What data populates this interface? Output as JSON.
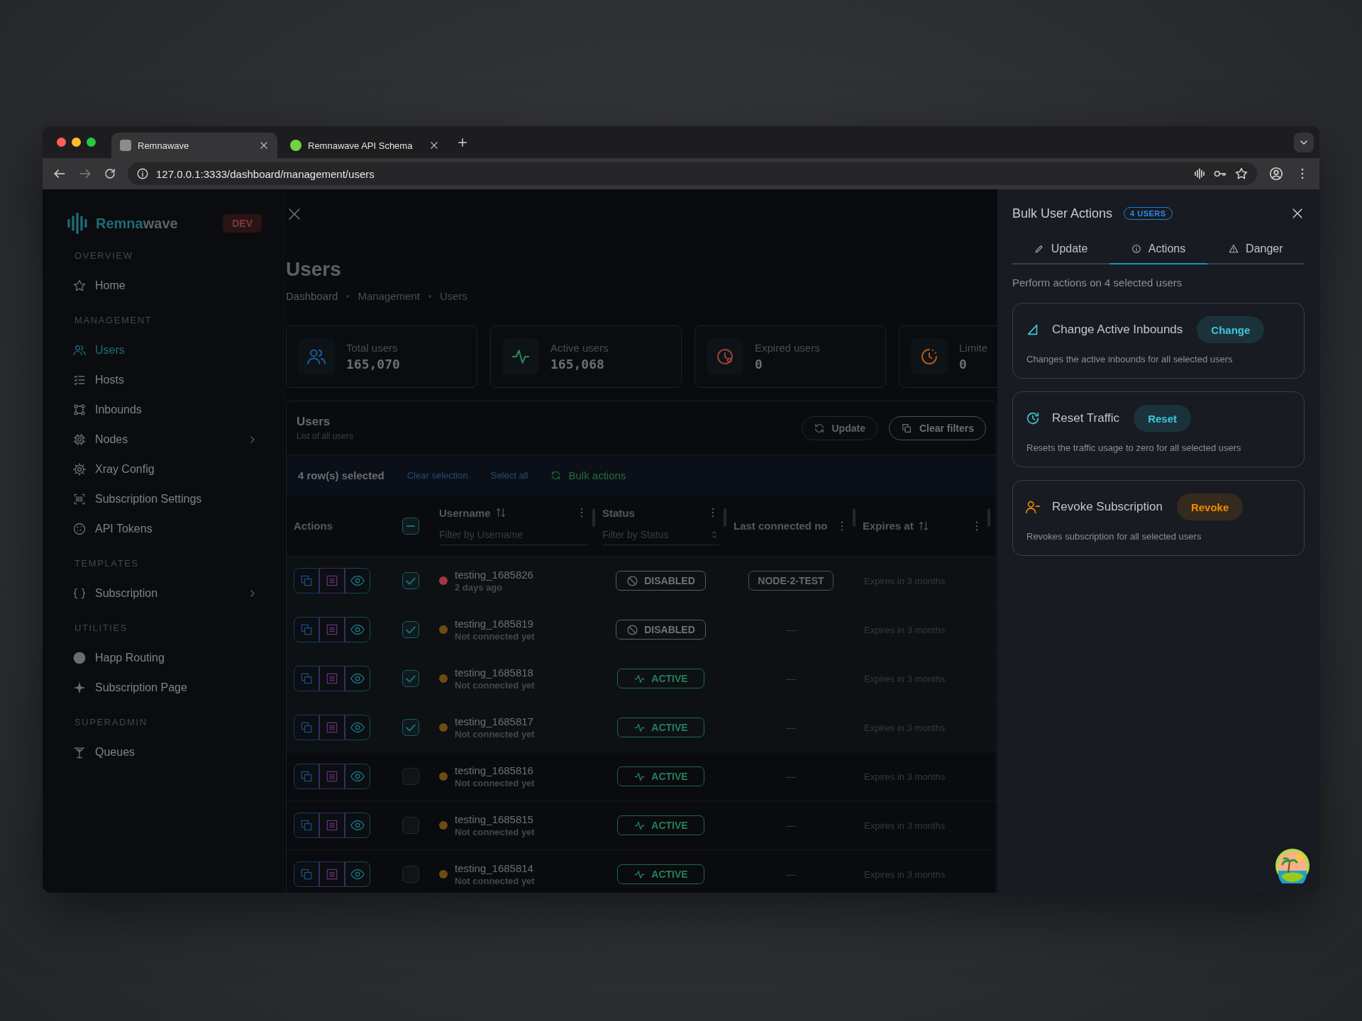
{
  "browser": {
    "tabs": [
      {
        "title": "Remnawave",
        "selected": true
      },
      {
        "title": "Remnawave API Schema",
        "selected": false
      }
    ],
    "url": "127.0.0.1:3333/dashboard/management/users"
  },
  "sidebar": {
    "brand_highlight": "Remna",
    "brand_rest": "wave",
    "badge": "DEV",
    "sections": [
      {
        "heading": "OVERVIEW",
        "items": [
          {
            "label": "Home",
            "selected": false,
            "submenu": false
          }
        ]
      },
      {
        "heading": "MANAGEMENT",
        "items": [
          {
            "label": "Users",
            "selected": true,
            "submenu": false
          },
          {
            "label": "Hosts",
            "selected": false,
            "submenu": false
          },
          {
            "label": "Inbounds",
            "selected": false,
            "submenu": false
          },
          {
            "label": "Nodes",
            "selected": false,
            "submenu": true
          },
          {
            "label": "Xray Config",
            "selected": false,
            "submenu": false
          },
          {
            "label": "Subscription Settings",
            "selected": false,
            "submenu": false
          },
          {
            "label": "API Tokens",
            "selected": false,
            "submenu": false
          }
        ]
      },
      {
        "heading": "TEMPLATES",
        "items": [
          {
            "label": "Subscription",
            "selected": false,
            "submenu": true
          }
        ]
      },
      {
        "heading": "UTILITIES",
        "items": [
          {
            "label": "Happ Routing",
            "selected": false,
            "submenu": false
          },
          {
            "label": "Subscription Page",
            "selected": false,
            "submenu": false
          }
        ]
      },
      {
        "heading": "SUPERADMIN",
        "items": [
          {
            "label": "Queues",
            "selected": false,
            "submenu": false
          }
        ]
      }
    ]
  },
  "page": {
    "title": "Users",
    "breadcrumbs": [
      "Dashboard",
      "Management",
      "Users"
    ],
    "stats": [
      {
        "label": "Total users",
        "value": "165,070",
        "color": "#1d5a9a"
      },
      {
        "label": "Active users",
        "value": "165,068",
        "color": "#278a5b"
      },
      {
        "label": "Expired users",
        "value": "0",
        "color": "#a0403a"
      },
      {
        "label": "Limite",
        "value": "0",
        "color": "#b0591c"
      }
    ]
  },
  "table": {
    "title": "Users",
    "subtitle": "List of all users",
    "buttons": [
      {
        "label": "Update",
        "kind": "subtle"
      },
      {
        "label": "Clear filters",
        "kind": "outline"
      }
    ],
    "selection": {
      "count": "4 row(s) selected",
      "links": [
        "Clear selection",
        "Select all"
      ],
      "bulk": "Bulk actions"
    },
    "header_checkbox_partial": true,
    "columns": [
      {
        "label": "Actions",
        "sortable": false,
        "menu": false
      },
      {
        "label": "Username",
        "sortable": true,
        "menu": true,
        "filter": "Filter by Username",
        "filter_select": false
      },
      {
        "label": "Status",
        "sortable": false,
        "menu": true,
        "filter": "Filter by Status",
        "filter_select": true
      },
      {
        "label": "Last connected no",
        "sortable": false,
        "menu": true
      },
      {
        "label": "Expires at",
        "sortable": true,
        "menu": true
      }
    ],
    "rows": [
      {
        "username": "testing_1685826",
        "seen": "2 days ago",
        "color": "#a3393f",
        "selected": true,
        "status": {
          "kind": "disabled",
          "label": "DISABLED"
        },
        "last_connected": {
          "kind": "badge",
          "text": "NODE-2-TEST"
        },
        "expires": "Expires in 3 months"
      },
      {
        "username": "testing_1685819",
        "seen": "Not connected yet",
        "color": "#6e4c10",
        "selected": true,
        "status": {
          "kind": "disabled",
          "label": "DISABLED"
        },
        "last_connected": {
          "kind": "text",
          "text": "—"
        },
        "expires": "Expires in 3 months"
      },
      {
        "username": "testing_1685818",
        "seen": "Not connected yet",
        "color": "#6e4c10",
        "selected": true,
        "status": {
          "kind": "active",
          "label": "ACTIVE"
        },
        "last_connected": {
          "kind": "text",
          "text": "—"
        },
        "expires": "Expires in 3 months"
      },
      {
        "username": "testing_1685817",
        "seen": "Not connected yet",
        "color": "#6e4c10",
        "selected": true,
        "status": {
          "kind": "active",
          "label": "ACTIVE"
        },
        "last_connected": {
          "kind": "text",
          "text": "—"
        },
        "expires": "Expires in 3 months"
      },
      {
        "username": "testing_1685816",
        "seen": "Not connected yet",
        "color": "#6e4c10",
        "selected": false,
        "status": {
          "kind": "active",
          "label": "ACTIVE"
        },
        "last_connected": {
          "kind": "text",
          "text": "—"
        },
        "expires": "Expires in 3 months"
      },
      {
        "username": "testing_1685815",
        "seen": "Not connected yet",
        "color": "#6e4c10",
        "selected": false,
        "status": {
          "kind": "active",
          "label": "ACTIVE"
        },
        "last_connected": {
          "kind": "text",
          "text": "—"
        },
        "expires": "Expires in 3 months"
      },
      {
        "username": "testing_1685814",
        "seen": "Not connected yet",
        "color": "#6e4c10",
        "selected": false,
        "status": {
          "kind": "active",
          "label": "ACTIVE"
        },
        "last_connected": {
          "kind": "text",
          "text": "—"
        },
        "expires": "Expires in 3 months"
      }
    ]
  },
  "drawer": {
    "title": "Bulk User Actions",
    "badge": "4 USERS",
    "tabs": [
      {
        "label": "Update",
        "selected": false
      },
      {
        "label": "Actions",
        "selected": true
      },
      {
        "label": "Danger",
        "selected": false
      }
    ],
    "description": "Perform actions on 4 selected users",
    "actions": [
      {
        "title": "Change Active Inbounds",
        "button": "Change",
        "description": "Changes the active inbounds for all selected users",
        "color": "#3bc9db"
      },
      {
        "title": "Reset Traffic",
        "button": "Reset",
        "description": "Resets the traffic usage to zero for all selected users",
        "color": "#3bc9db"
      },
      {
        "title": "Revoke Subscription",
        "button": "Revoke",
        "description": "Revokes subscription for all selected users",
        "color": "#f08c00"
      }
    ]
  }
}
